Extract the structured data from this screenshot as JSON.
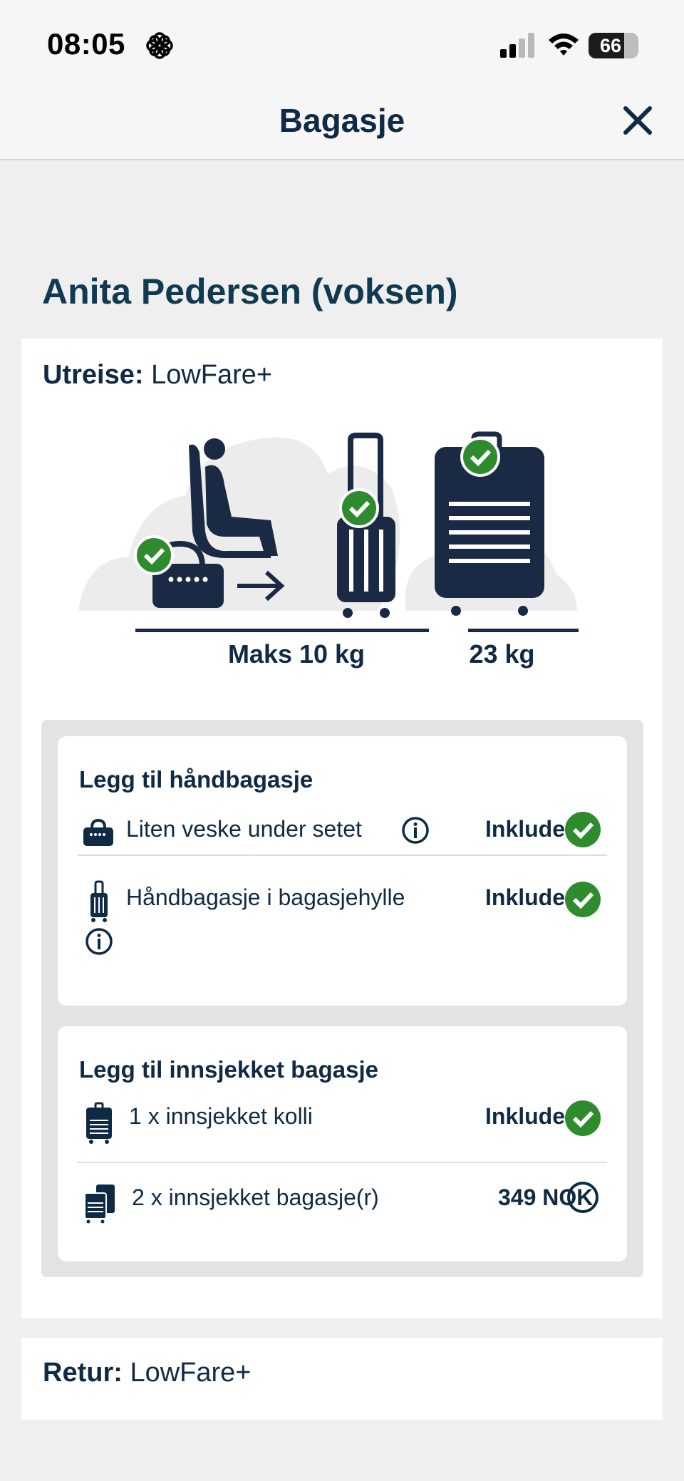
{
  "status_bar": {
    "time": "08:05",
    "battery": "66"
  },
  "header": {
    "title": "Bagasje"
  },
  "passenger": {
    "name": "Anita Pedersen (voksen)"
  },
  "outbound": {
    "label": "Utreise:",
    "fare": "LowFare+",
    "cabin_weight": "Maks 10 kg",
    "checked_weight": "23 kg",
    "hand_section": {
      "title": "Legg til håndbagasje",
      "items": [
        {
          "label": "Liten veske under setet",
          "status": "Inkludert"
        },
        {
          "label": "Håndbagasje i bagasjehylle",
          "status": "Inkludert"
        }
      ]
    },
    "checked_section": {
      "title": "Legg til innsjekket bagasje",
      "items": [
        {
          "label": "1 x innsjekket kolli",
          "status": "Inkludert"
        },
        {
          "label": "2 x innsjekket bagasje(r)",
          "status": "349 NOK"
        }
      ]
    }
  },
  "return": {
    "label": "Retur:",
    "fare": "LowFare+"
  },
  "colors": {
    "navy": "#0f2a44",
    "check_green": "#2e8b2e",
    "cloud": "#ececec"
  },
  "icons": [
    "flower-icon",
    "signal-icon",
    "wifi-icon",
    "battery-icon",
    "close-icon",
    "seat-icon",
    "bag-icon",
    "trolley-icon",
    "suitcase-icon",
    "check-icon",
    "info-icon",
    "radio-icon"
  ]
}
